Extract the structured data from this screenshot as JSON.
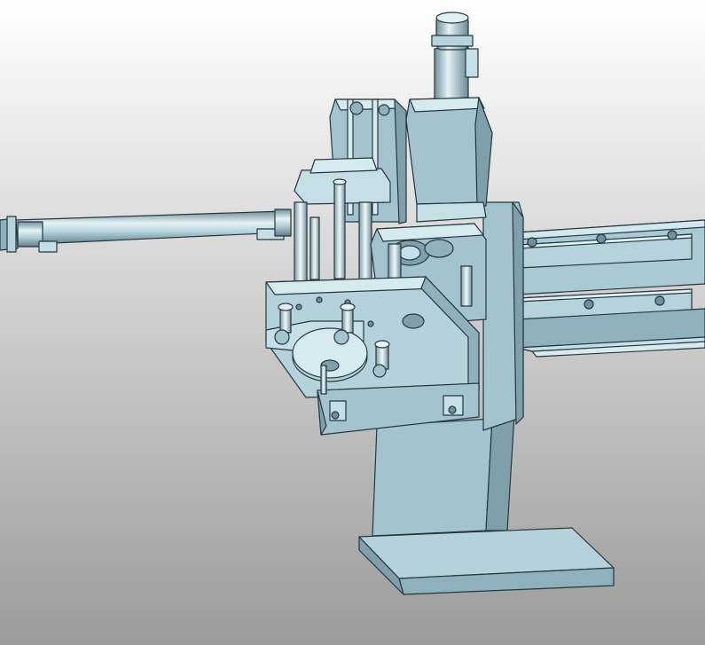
{
  "viewport": {
    "background_top": "#ffffff",
    "background_bottom": "#9b9b9b"
  },
  "model": {
    "parts": [
      "base-plate",
      "vertical-column",
      "linear-rail",
      "ball-screw-shaft",
      "servo-motor",
      "pneumatic-cylinder",
      "carriage-plate",
      "gripper-flange"
    ],
    "colors": {
      "face_light": "#c6dee6",
      "face_mid": "#a3c4cf",
      "face_dark": "#7f9fab",
      "edge": "#27373d",
      "shaft_light": "#e6f2f6",
      "shaft_dark": "#6f8f9b"
    }
  }
}
